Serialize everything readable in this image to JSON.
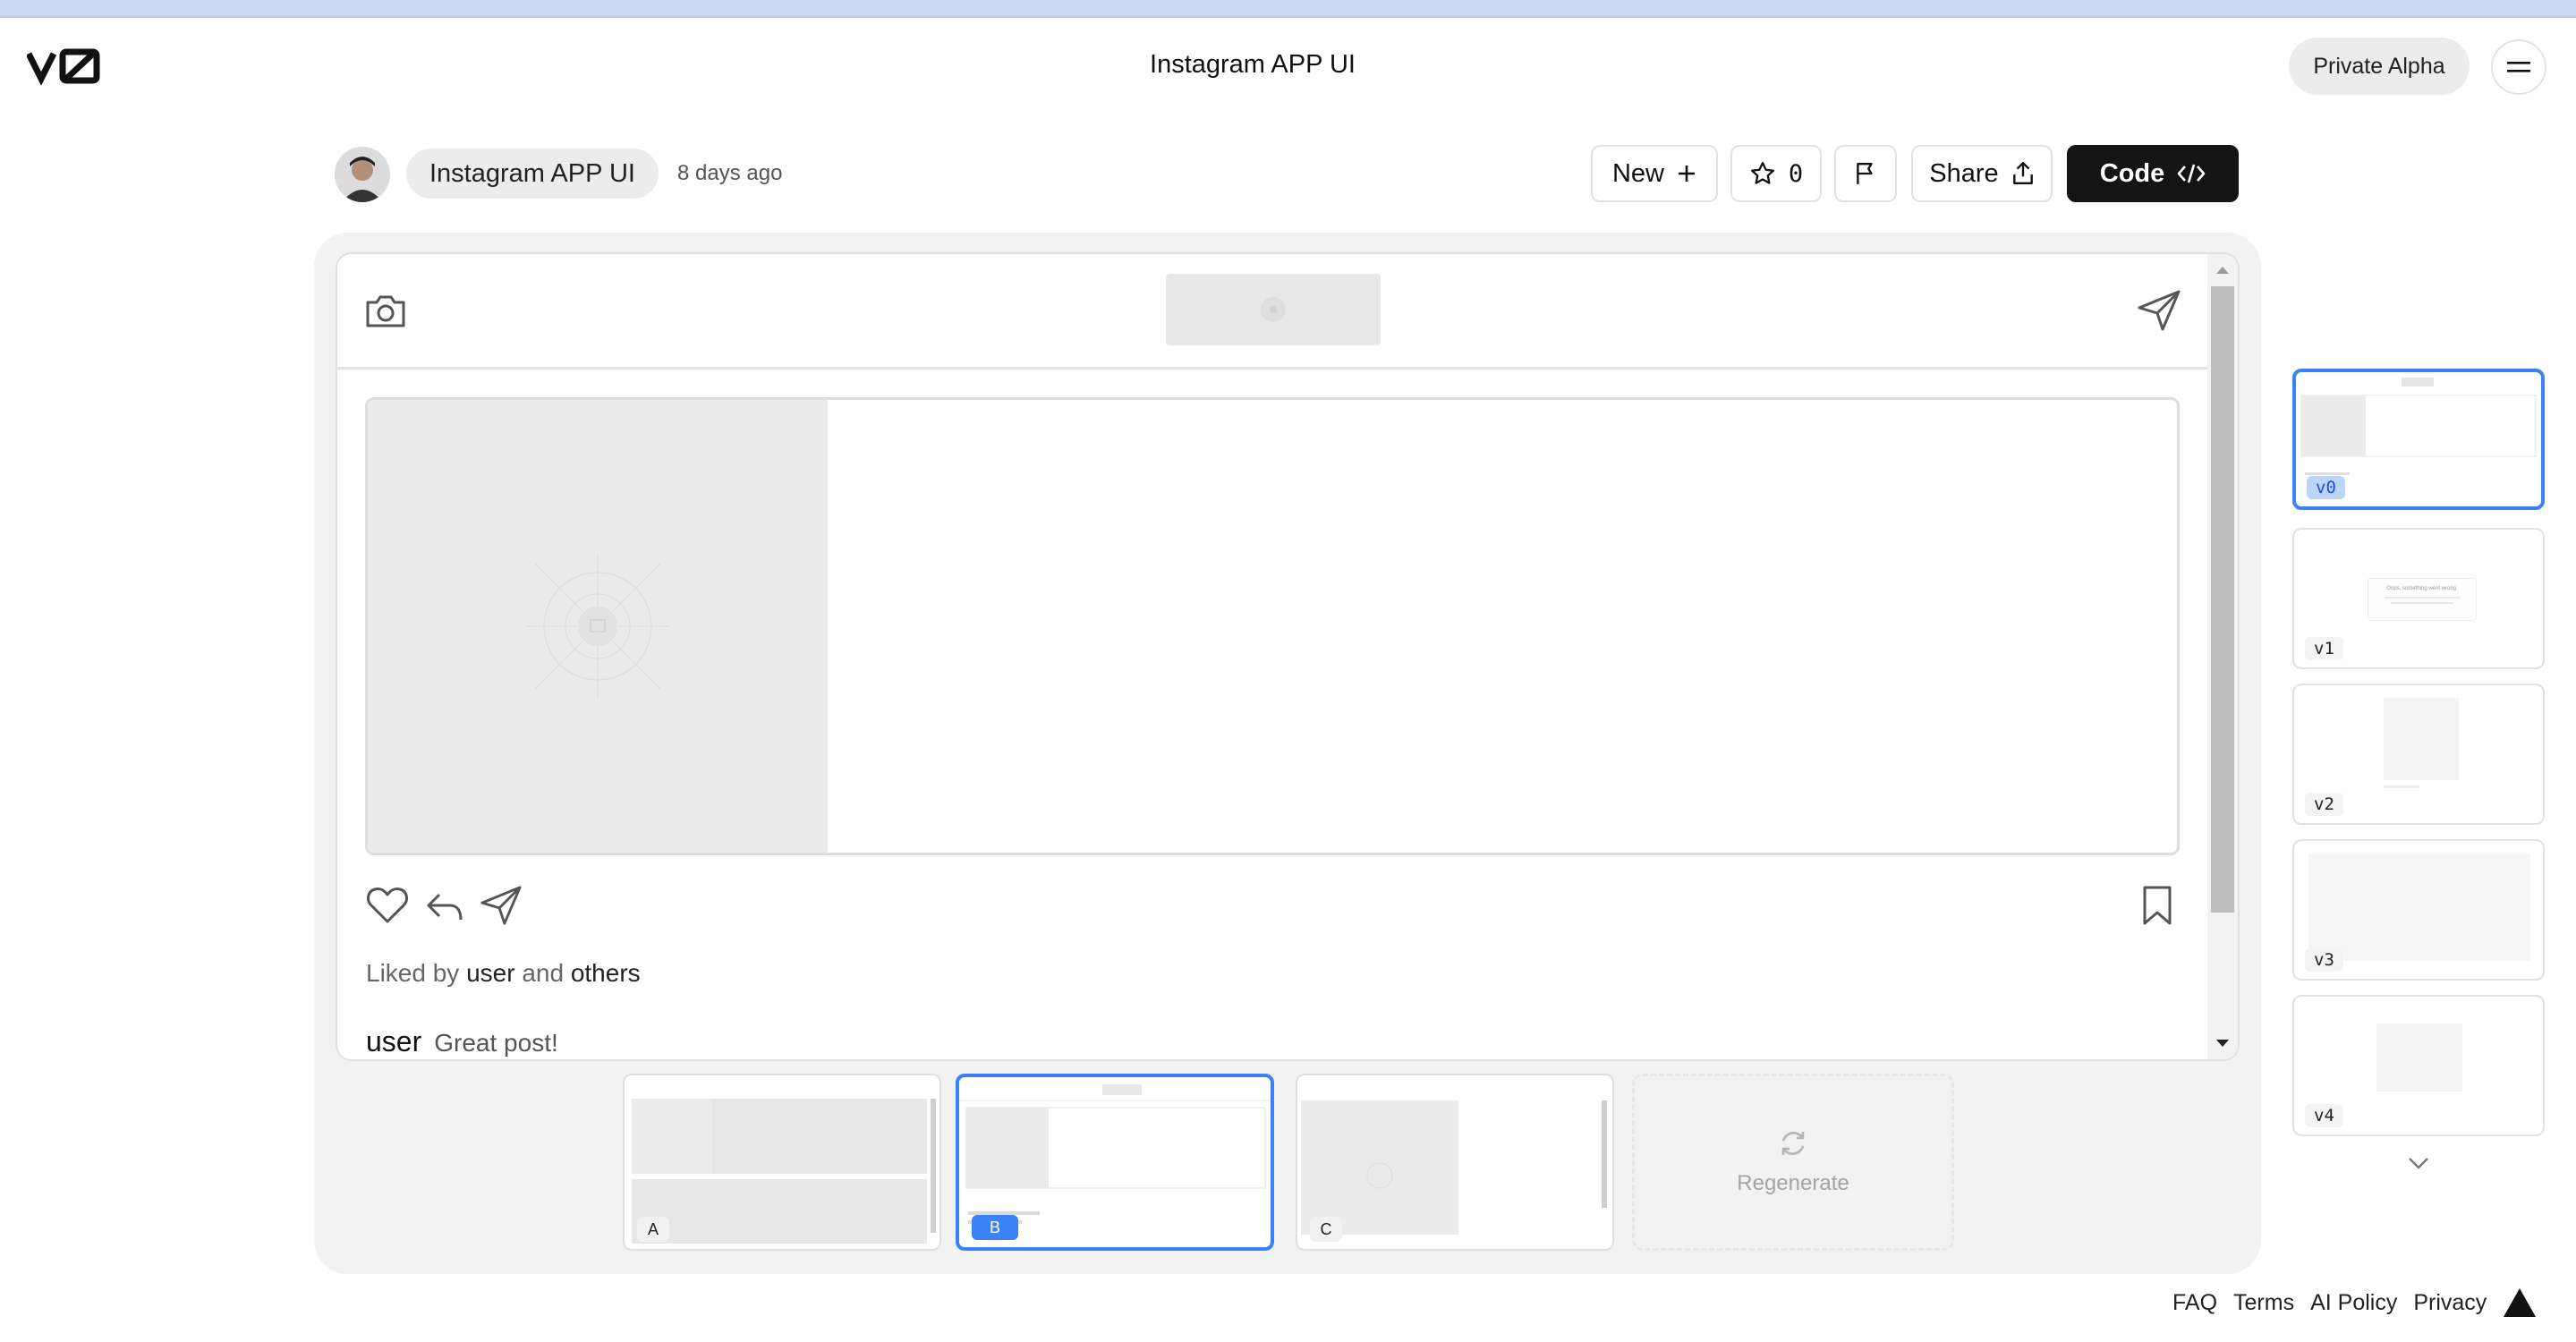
{
  "app": {
    "logo_icon": "v0-logo",
    "title": "Instagram APP UI",
    "badge": "Private Alpha",
    "menu_icon": "menu-icon"
  },
  "toolbar": {
    "project_name": "Instagram APP UI",
    "time_ago": "8 days ago",
    "new_label": "New",
    "star_count": "0",
    "share_label": "Share",
    "code_label": "Code"
  },
  "preview": {
    "likes_prefix": "Liked by",
    "likes_user": "user",
    "likes_and": "and",
    "likes_others": "others",
    "comment_user": "user",
    "comment_text": "Great post!"
  },
  "variants": [
    {
      "label": "A",
      "selected": false
    },
    {
      "label": "B",
      "selected": true
    },
    {
      "label": "C",
      "selected": false
    }
  ],
  "regenerate_label": "Regenerate",
  "versions": [
    {
      "label": "v0",
      "selected": true
    },
    {
      "label": "v1",
      "selected": false
    },
    {
      "label": "v2",
      "selected": false
    },
    {
      "label": "v3",
      "selected": false
    },
    {
      "label": "v4",
      "selected": false
    }
  ],
  "thumb_v1": {
    "title": "Oops, something went wrong."
  },
  "footer": {
    "faq": "FAQ",
    "terms": "Terms",
    "ai_policy": "AI Policy",
    "privacy": "Privacy"
  },
  "colors": {
    "accent": "#3b82f6",
    "code_button": "#141414",
    "canvas_bg": "#f2f2f2"
  }
}
